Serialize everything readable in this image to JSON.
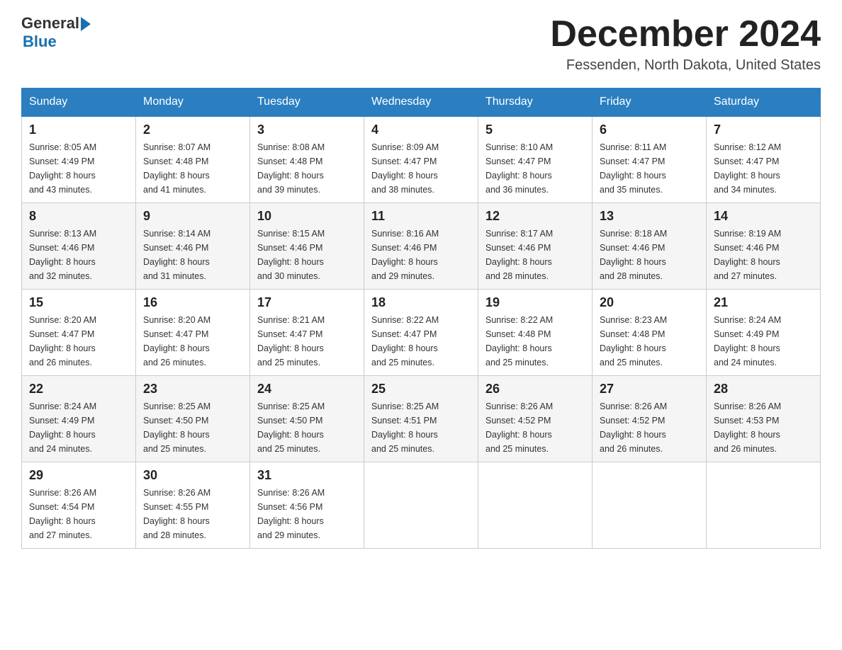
{
  "header": {
    "logo": {
      "general": "General",
      "arrow": "▶",
      "blue": "Blue"
    },
    "title": "December 2024",
    "location": "Fessenden, North Dakota, United States"
  },
  "days_of_week": [
    "Sunday",
    "Monday",
    "Tuesday",
    "Wednesday",
    "Thursday",
    "Friday",
    "Saturday"
  ],
  "weeks": [
    [
      {
        "day": "1",
        "sunrise": "8:05 AM",
        "sunset": "4:49 PM",
        "daylight": "8 hours and 43 minutes."
      },
      {
        "day": "2",
        "sunrise": "8:07 AM",
        "sunset": "4:48 PM",
        "daylight": "8 hours and 41 minutes."
      },
      {
        "day": "3",
        "sunrise": "8:08 AM",
        "sunset": "4:48 PM",
        "daylight": "8 hours and 39 minutes."
      },
      {
        "day": "4",
        "sunrise": "8:09 AM",
        "sunset": "4:47 PM",
        "daylight": "8 hours and 38 minutes."
      },
      {
        "day": "5",
        "sunrise": "8:10 AM",
        "sunset": "4:47 PM",
        "daylight": "8 hours and 36 minutes."
      },
      {
        "day": "6",
        "sunrise": "8:11 AM",
        "sunset": "4:47 PM",
        "daylight": "8 hours and 35 minutes."
      },
      {
        "day": "7",
        "sunrise": "8:12 AM",
        "sunset": "4:47 PM",
        "daylight": "8 hours and 34 minutes."
      }
    ],
    [
      {
        "day": "8",
        "sunrise": "8:13 AM",
        "sunset": "4:46 PM",
        "daylight": "8 hours and 32 minutes."
      },
      {
        "day": "9",
        "sunrise": "8:14 AM",
        "sunset": "4:46 PM",
        "daylight": "8 hours and 31 minutes."
      },
      {
        "day": "10",
        "sunrise": "8:15 AM",
        "sunset": "4:46 PM",
        "daylight": "8 hours and 30 minutes."
      },
      {
        "day": "11",
        "sunrise": "8:16 AM",
        "sunset": "4:46 PM",
        "daylight": "8 hours and 29 minutes."
      },
      {
        "day": "12",
        "sunrise": "8:17 AM",
        "sunset": "4:46 PM",
        "daylight": "8 hours and 28 minutes."
      },
      {
        "day": "13",
        "sunrise": "8:18 AM",
        "sunset": "4:46 PM",
        "daylight": "8 hours and 28 minutes."
      },
      {
        "day": "14",
        "sunrise": "8:19 AM",
        "sunset": "4:46 PM",
        "daylight": "8 hours and 27 minutes."
      }
    ],
    [
      {
        "day": "15",
        "sunrise": "8:20 AM",
        "sunset": "4:47 PM",
        "daylight": "8 hours and 26 minutes."
      },
      {
        "day": "16",
        "sunrise": "8:20 AM",
        "sunset": "4:47 PM",
        "daylight": "8 hours and 26 minutes."
      },
      {
        "day": "17",
        "sunrise": "8:21 AM",
        "sunset": "4:47 PM",
        "daylight": "8 hours and 25 minutes."
      },
      {
        "day": "18",
        "sunrise": "8:22 AM",
        "sunset": "4:47 PM",
        "daylight": "8 hours and 25 minutes."
      },
      {
        "day": "19",
        "sunrise": "8:22 AM",
        "sunset": "4:48 PM",
        "daylight": "8 hours and 25 minutes."
      },
      {
        "day": "20",
        "sunrise": "8:23 AM",
        "sunset": "4:48 PM",
        "daylight": "8 hours and 25 minutes."
      },
      {
        "day": "21",
        "sunrise": "8:24 AM",
        "sunset": "4:49 PM",
        "daylight": "8 hours and 24 minutes."
      }
    ],
    [
      {
        "day": "22",
        "sunrise": "8:24 AM",
        "sunset": "4:49 PM",
        "daylight": "8 hours and 24 minutes."
      },
      {
        "day": "23",
        "sunrise": "8:25 AM",
        "sunset": "4:50 PM",
        "daylight": "8 hours and 25 minutes."
      },
      {
        "day": "24",
        "sunrise": "8:25 AM",
        "sunset": "4:50 PM",
        "daylight": "8 hours and 25 minutes."
      },
      {
        "day": "25",
        "sunrise": "8:25 AM",
        "sunset": "4:51 PM",
        "daylight": "8 hours and 25 minutes."
      },
      {
        "day": "26",
        "sunrise": "8:26 AM",
        "sunset": "4:52 PM",
        "daylight": "8 hours and 25 minutes."
      },
      {
        "day": "27",
        "sunrise": "8:26 AM",
        "sunset": "4:52 PM",
        "daylight": "8 hours and 26 minutes."
      },
      {
        "day": "28",
        "sunrise": "8:26 AM",
        "sunset": "4:53 PM",
        "daylight": "8 hours and 26 minutes."
      }
    ],
    [
      {
        "day": "29",
        "sunrise": "8:26 AM",
        "sunset": "4:54 PM",
        "daylight": "8 hours and 27 minutes."
      },
      {
        "day": "30",
        "sunrise": "8:26 AM",
        "sunset": "4:55 PM",
        "daylight": "8 hours and 28 minutes."
      },
      {
        "day": "31",
        "sunrise": "8:26 AM",
        "sunset": "4:56 PM",
        "daylight": "8 hours and 29 minutes."
      },
      null,
      null,
      null,
      null
    ]
  ],
  "labels": {
    "sunrise": "Sunrise:",
    "sunset": "Sunset:",
    "daylight": "Daylight:"
  }
}
